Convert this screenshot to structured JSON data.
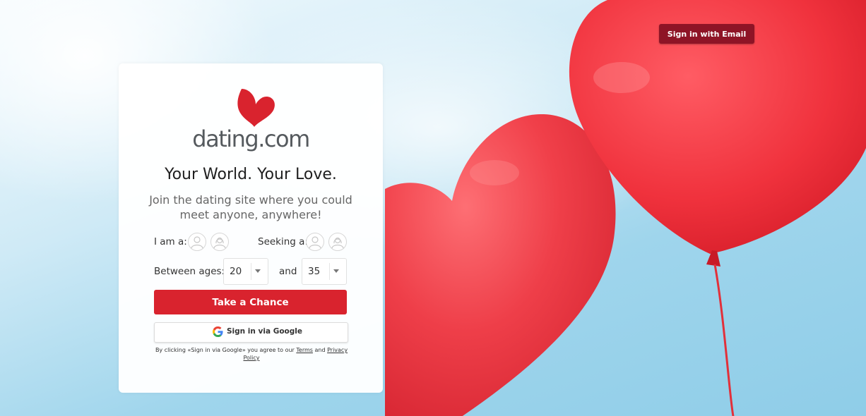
{
  "header": {
    "signin_email_label": "Sign in with Email"
  },
  "logo": {
    "text": "dating.com"
  },
  "card": {
    "headline": "Your World. Your Love.",
    "subline": "Join the dating site where you could meet anyone, anywhere!",
    "iam_label": "I am a:",
    "seeking_label": "Seeking a:",
    "ages_label": "Between ages:",
    "and_label": "and",
    "age_min": "20",
    "age_max": "35",
    "cta_label": "Take a Chance",
    "google_label": "Sign in via Google",
    "legal_prefix": "By clicking «Sign in via Google» you agree to our",
    "terms_label": "Terms",
    "legal_and": "and",
    "privacy_label": "Privacy Policy"
  },
  "colors": {
    "brand_red": "#d9232e",
    "email_button": "#8e1426",
    "sky": "#9fd5ec"
  },
  "icons": [
    "heart-logo-icon",
    "male-avatar-icon",
    "female-avatar-icon",
    "chevron-down-icon",
    "google-icon"
  ]
}
